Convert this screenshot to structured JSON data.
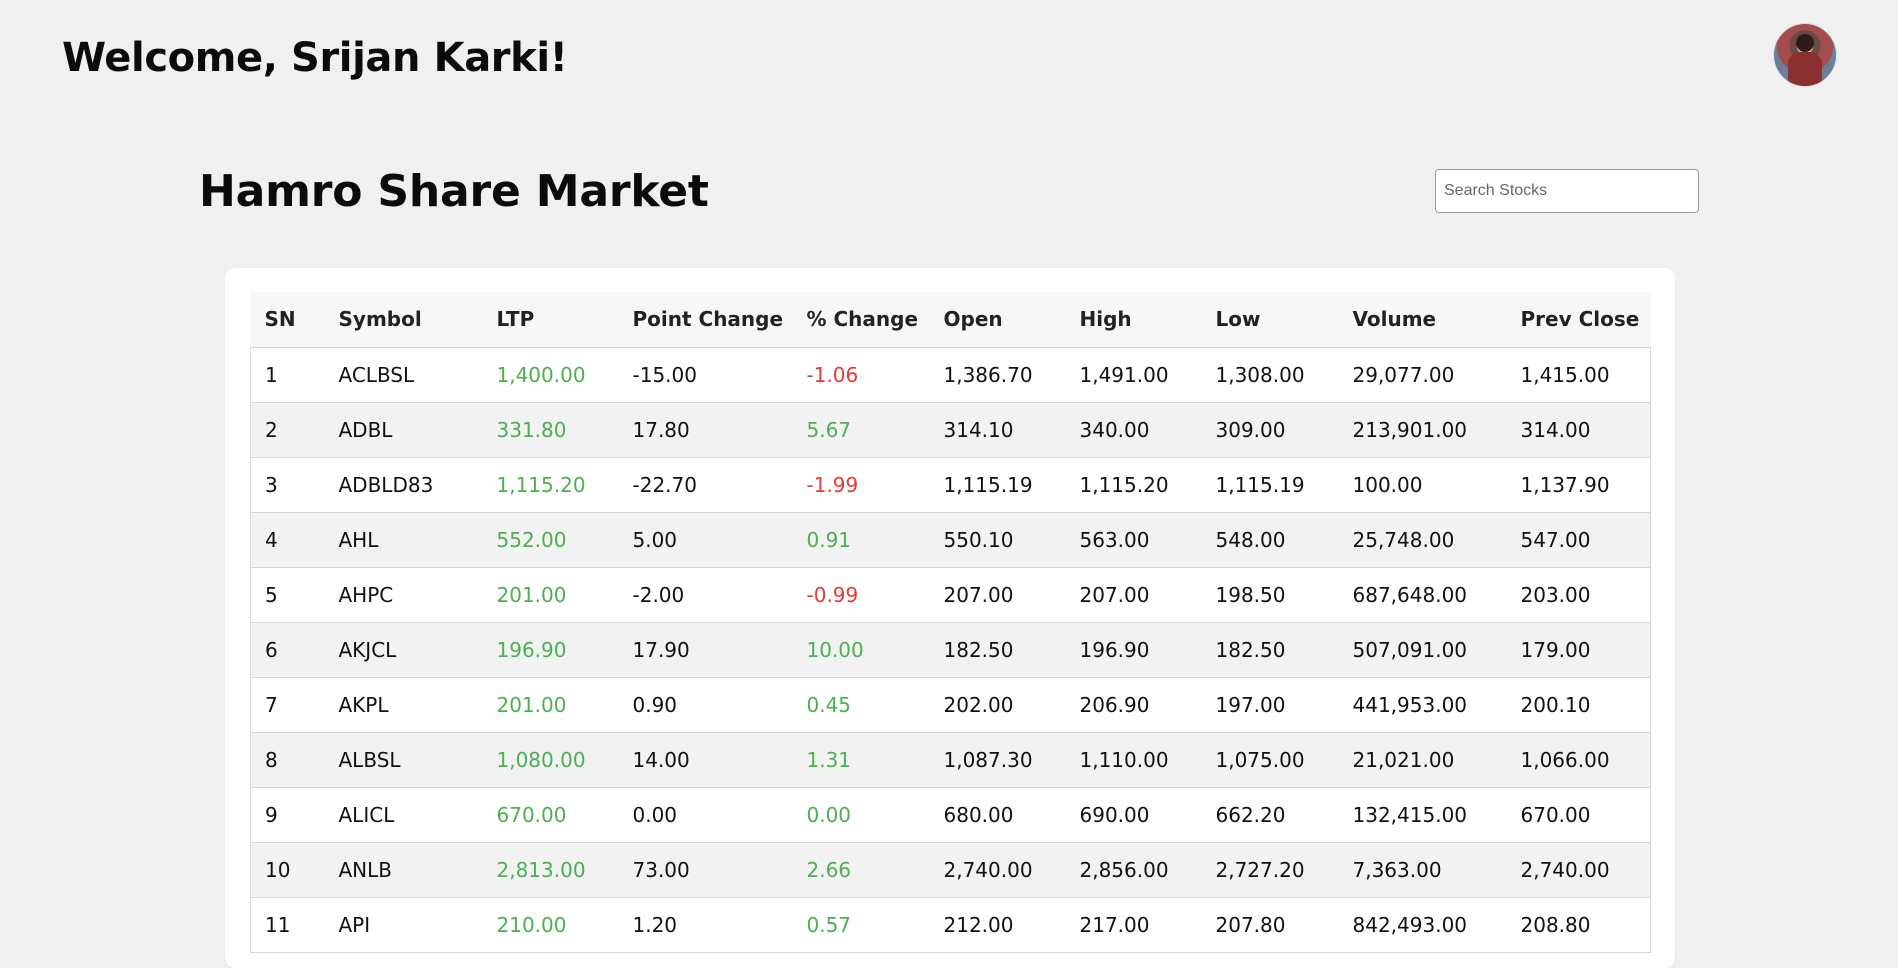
{
  "header": {
    "welcome_text": "Welcome, Srijan Karki!",
    "avatar_icon": "user-avatar-icon"
  },
  "market": {
    "title": "Hamro Share Market",
    "search_placeholder": "Search Stocks"
  },
  "colors": {
    "positive": "#4caf50",
    "negative": "#e53935",
    "page_background": "#f0f0f0",
    "card_background": "#ffffff"
  },
  "table": {
    "columns": [
      "SN",
      "Symbol",
      "LTP",
      "Point Change",
      "% Change",
      "Open",
      "High",
      "Low",
      "Volume",
      "Prev Close"
    ],
    "rows": [
      {
        "sn": "1",
        "symbol": "ACLBSL",
        "ltp": "1,400.00",
        "point_change": "-15.00",
        "pct_change": "-1.06",
        "open": "1,386.70",
        "high": "1,491.00",
        "low": "1,308.00",
        "volume": "29,077.00",
        "prev_close": "1,415.00"
      },
      {
        "sn": "2",
        "symbol": "ADBL",
        "ltp": "331.80",
        "point_change": "17.80",
        "pct_change": "5.67",
        "open": "314.10",
        "high": "340.00",
        "low": "309.00",
        "volume": "213,901.00",
        "prev_close": "314.00"
      },
      {
        "sn": "3",
        "symbol": "ADBLD83",
        "ltp": "1,115.20",
        "point_change": "-22.70",
        "pct_change": "-1.99",
        "open": "1,115.19",
        "high": "1,115.20",
        "low": "1,115.19",
        "volume": "100.00",
        "prev_close": "1,137.90"
      },
      {
        "sn": "4",
        "symbol": "AHL",
        "ltp": "552.00",
        "point_change": "5.00",
        "pct_change": "0.91",
        "open": "550.10",
        "high": "563.00",
        "low": "548.00",
        "volume": "25,748.00",
        "prev_close": "547.00"
      },
      {
        "sn": "5",
        "symbol": "AHPC",
        "ltp": "201.00",
        "point_change": "-2.00",
        "pct_change": "-0.99",
        "open": "207.00",
        "high": "207.00",
        "low": "198.50",
        "volume": "687,648.00",
        "prev_close": "203.00"
      },
      {
        "sn": "6",
        "symbol": "AKJCL",
        "ltp": "196.90",
        "point_change": "17.90",
        "pct_change": "10.00",
        "open": "182.50",
        "high": "196.90",
        "low": "182.50",
        "volume": "507,091.00",
        "prev_close": "179.00"
      },
      {
        "sn": "7",
        "symbol": "AKPL",
        "ltp": "201.00",
        "point_change": "0.90",
        "pct_change": "0.45",
        "open": "202.00",
        "high": "206.90",
        "low": "197.00",
        "volume": "441,953.00",
        "prev_close": "200.10"
      },
      {
        "sn": "8",
        "symbol": "ALBSL",
        "ltp": "1,080.00",
        "point_change": "14.00",
        "pct_change": "1.31",
        "open": "1,087.30",
        "high": "1,110.00",
        "low": "1,075.00",
        "volume": "21,021.00",
        "prev_close": "1,066.00"
      },
      {
        "sn": "9",
        "symbol": "ALICL",
        "ltp": "670.00",
        "point_change": "0.00",
        "pct_change": "0.00",
        "open": "680.00",
        "high": "690.00",
        "low": "662.20",
        "volume": "132,415.00",
        "prev_close": "670.00"
      },
      {
        "sn": "10",
        "symbol": "ANLB",
        "ltp": "2,813.00",
        "point_change": "73.00",
        "pct_change": "2.66",
        "open": "2,740.00",
        "high": "2,856.00",
        "low": "2,727.20",
        "volume": "7,363.00",
        "prev_close": "2,740.00"
      },
      {
        "sn": "11",
        "symbol": "API",
        "ltp": "210.00",
        "point_change": "1.20",
        "pct_change": "0.57",
        "open": "212.00",
        "high": "217.00",
        "low": "207.80",
        "volume": "842,493.00",
        "prev_close": "208.80"
      }
    ]
  }
}
